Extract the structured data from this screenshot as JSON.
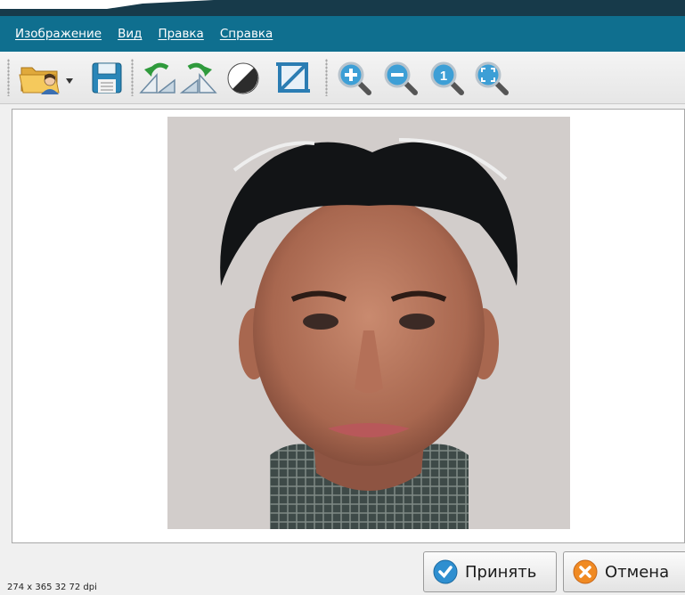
{
  "menu": {
    "items": [
      {
        "label": "Изображение"
      },
      {
        "label": "Вид"
      },
      {
        "label": "Правка"
      },
      {
        "label": "Справка"
      }
    ]
  },
  "toolbar": {
    "buttons": [
      {
        "icon": "open-folder-icon"
      },
      {
        "icon": "save-icon"
      },
      {
        "icon": "rotate-left-icon"
      },
      {
        "icon": "rotate-right-icon"
      },
      {
        "icon": "grayscale-icon"
      },
      {
        "icon": "crop-icon"
      },
      {
        "icon": "zoom-in-icon"
      },
      {
        "icon": "zoom-out-icon"
      },
      {
        "icon": "zoom-actual-size-icon"
      },
      {
        "icon": "zoom-fit-icon"
      }
    ]
  },
  "status": {
    "image_info": "274 x 365 32 72 dpi"
  },
  "buttons": {
    "accept_label": "Принять",
    "cancel_label": "Отмена"
  },
  "colors": {
    "menubar": "#0f6f8f",
    "photo_background": "#d2cdcb"
  }
}
